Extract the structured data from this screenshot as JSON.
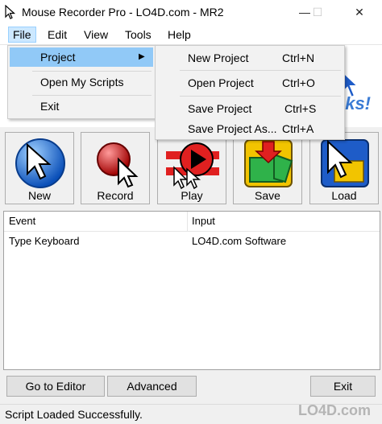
{
  "window": {
    "title": "Mouse Recorder Pro - LO4D.com - MR2",
    "minimize": "—",
    "maximize": "☐",
    "close": "✕"
  },
  "menubar": {
    "file": "File",
    "edit": "Edit",
    "view": "View",
    "tools": "Tools",
    "help": "Help"
  },
  "banner": {
    "text": "ks!"
  },
  "file_menu": {
    "project": "Project",
    "open_scripts": "Open My Scripts",
    "exit": "Exit"
  },
  "project_menu": {
    "items": [
      {
        "label": "New Project",
        "shortcut": "Ctrl+N"
      },
      {
        "label": "Open Project",
        "shortcut": "Ctrl+O"
      },
      {
        "label": "Save Project",
        "shortcut": "Ctrl+S"
      },
      {
        "label": "Save Project As...",
        "shortcut": "Ctrl+A"
      }
    ]
  },
  "toolbar": {
    "new": "New",
    "record": "Record",
    "play": "Play",
    "save": "Save",
    "load": "Load"
  },
  "list": {
    "columns": [
      "Event",
      "Input"
    ],
    "rows": [
      {
        "event": "Type Keyboard",
        "input": "LO4D.com Software"
      }
    ]
  },
  "buttons": {
    "editor": "Go to Editor",
    "advanced": "Advanced",
    "exit": "Exit"
  },
  "status": "Script Loaded Successfully.",
  "watermark": "LO4D.com"
}
